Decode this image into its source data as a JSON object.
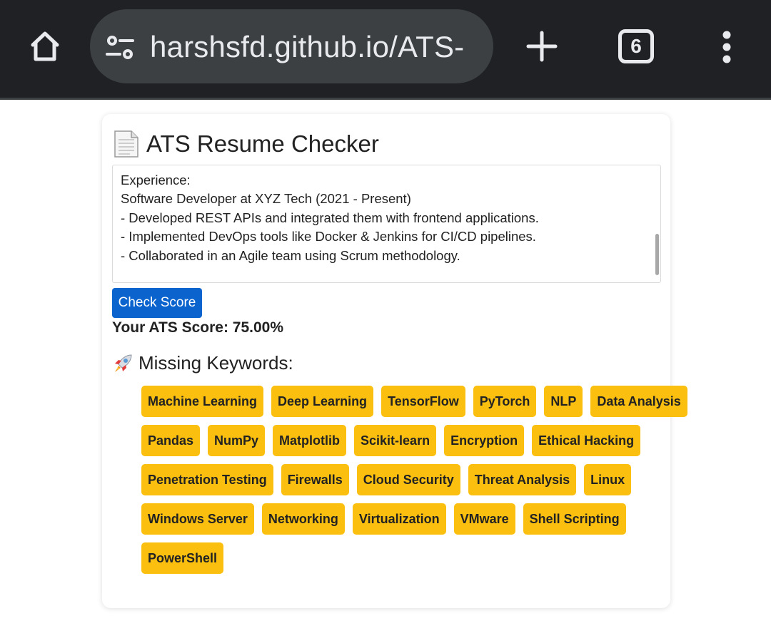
{
  "browser": {
    "url": "harshsfd.github.io/ATS-",
    "tab_count": "6",
    "icons": [
      "home-icon",
      "tune-icon",
      "plus-icon",
      "tab-switcher-icon",
      "more-vert-icon"
    ]
  },
  "page": {
    "title": "ATS Resume Checker",
    "title_icon": "page-facing-up-icon",
    "resume_lines": [
      "Experience:",
      "Software Developer at XYZ Tech (2021 - Present)",
      "- Developed REST APIs and integrated them with frontend applications.",
      "- Implemented DevOps tools like Docker & Jenkins for CI/CD pipelines.",
      "- Collaborated in an Agile team using Scrum methodology."
    ],
    "check_button_label": "Check Score",
    "score_text": "Your ATS Score: 75.00%",
    "missing_title": "Missing Keywords:",
    "missing_icon": "rocket-icon",
    "keyword_rows": [
      [
        "Machine Learning",
        "Deep Learning",
        "TensorFlow",
        "PyTorch",
        "NLP",
        "Data Analysis"
      ],
      [
        "Pandas",
        "NumPy",
        "Matplotlib",
        "Scikit-learn",
        "Encryption",
        "Ethical Hacking"
      ],
      [
        "Penetration Testing",
        "Firewalls",
        "Cloud Security",
        "Threat Analysis",
        "Linux"
      ],
      [
        "Windows Server",
        "Networking",
        "Virtualization",
        "VMware",
        "Shell Scripting"
      ],
      [
        "PowerShell"
      ]
    ]
  },
  "colors": {
    "toolbar_bg": "#202124",
    "urlbar_bg": "#3c4043",
    "button_blue": "#0b63ce",
    "chip_yellow": "#fbbf0f"
  }
}
